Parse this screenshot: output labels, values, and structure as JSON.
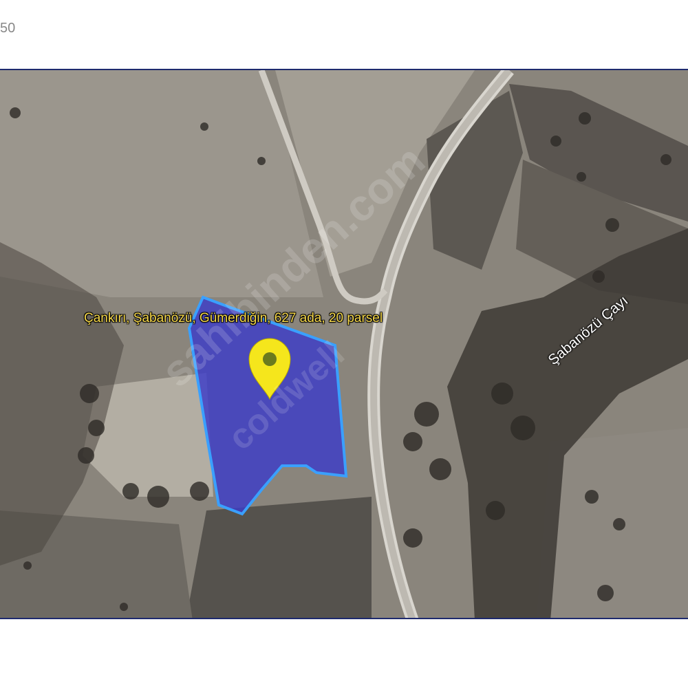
{
  "page": {
    "corner_text": "50"
  },
  "map": {
    "parcel_label": "Çankırı, Şabanözü, Gümerdiğin, 627 ada, 20 parsel",
    "river_label": "Şabanözü Çayı",
    "watermark_primary": "sahibinden.com",
    "watermark_secondary": "coldwell",
    "marker_icon": "location-pin-icon",
    "colors": {
      "parcel_fill": "#3c3cc8",
      "parcel_stroke": "#3aa0ff",
      "marker": "#f5e61c",
      "marker_dot": "#6b7a1e",
      "label_text": "#f6d84a",
      "frame_border": "#1e2a6e"
    }
  }
}
